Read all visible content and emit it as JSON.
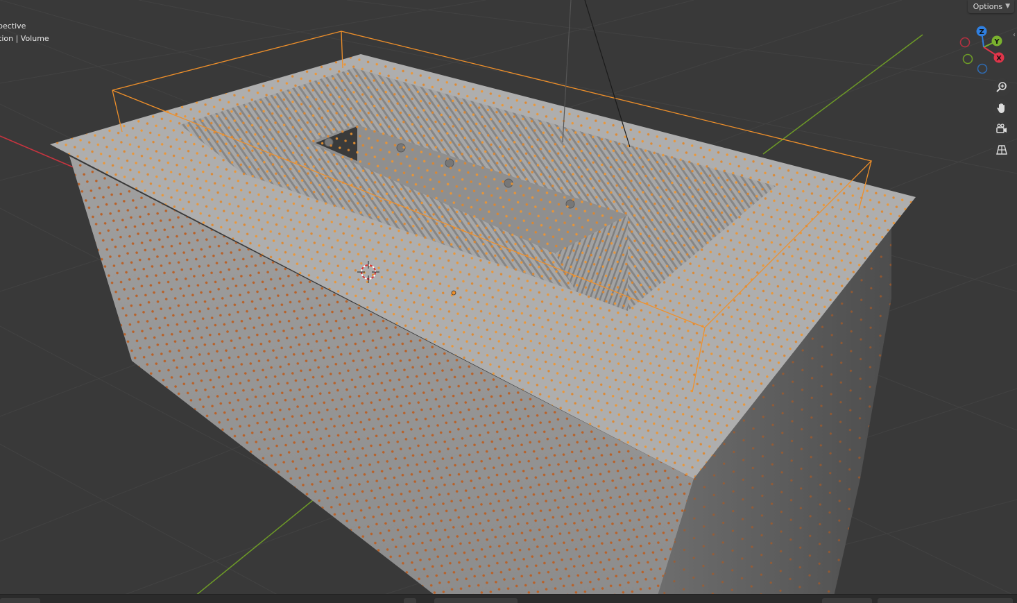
{
  "viewport": {
    "overlay_line1": "pective",
    "overlay_line2": "tion | Volume"
  },
  "header": {
    "options_label": "Options"
  },
  "gizmo": {
    "axes": [
      "Z",
      "Y",
      "X"
    ]
  },
  "nav_buttons": [
    "zoom-icon",
    "pan-hand-icon",
    "camera-icon",
    "grid-icon"
  ],
  "colors": {
    "background": "#393939",
    "selection_orange": "#f0902a",
    "axis_red": "#c8343f",
    "axis_green": "#6d9a27",
    "gizmo_z": "#2f7fe0",
    "gizmo_y": "#7ab22e",
    "gizmo_x": "#e0354a"
  }
}
